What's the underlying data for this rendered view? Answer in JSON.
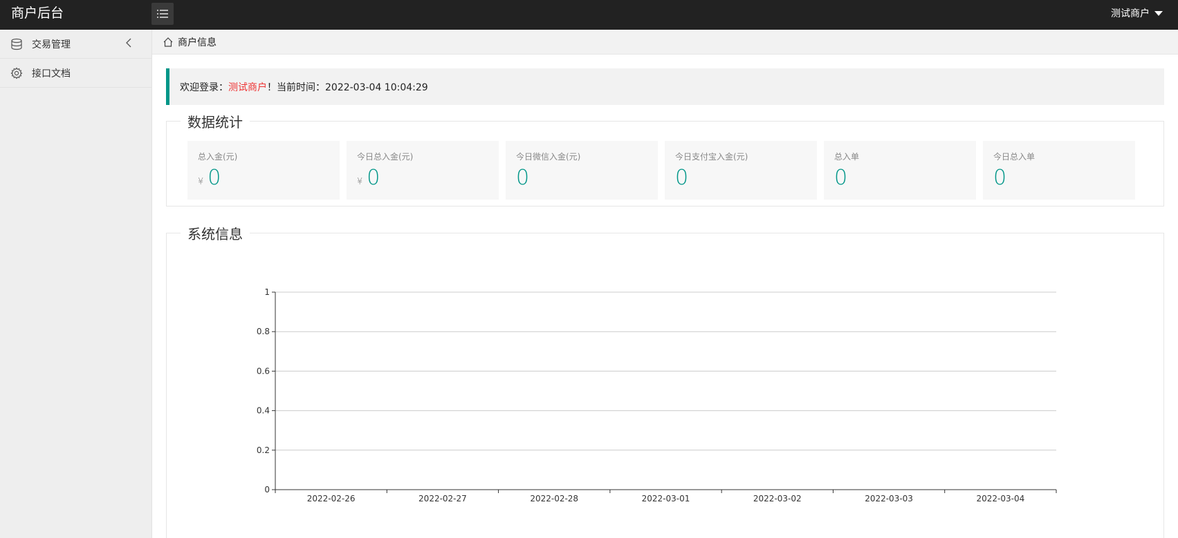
{
  "header": {
    "logo": "商户后台",
    "user": "测试商户"
  },
  "sidebar": {
    "items": [
      {
        "label": "交易管理",
        "icon": "database-icon"
      },
      {
        "label": "接口文档",
        "icon": "gear-icon"
      }
    ]
  },
  "breadcrumb": {
    "label": "商户信息"
  },
  "welcome": {
    "prefix": "欢迎登录：",
    "merchant": "测试商户",
    "suffix": "！当前时间：2022-03-04 10:04:29"
  },
  "stats_section": {
    "title": "数据统计",
    "items": [
      {
        "label": "总入金(元)",
        "currency": "¥",
        "value": "0"
      },
      {
        "label": "今日总入金(元)",
        "currency": "¥",
        "value": "0"
      },
      {
        "label": "今日微信入金(元)",
        "value": "0"
      },
      {
        "label": "今日支付宝入金(元)",
        "value": "0"
      },
      {
        "label": "总入单",
        "value": "0"
      },
      {
        "label": "今日总入单",
        "value": "0"
      }
    ]
  },
  "system_section": {
    "title": "系统信息"
  },
  "colors": {
    "accent": "#009688",
    "highlight": "#ee3333",
    "header_bg": "#222222"
  },
  "chart_data": {
    "type": "line",
    "title": "",
    "xlabel": "",
    "ylabel": "",
    "categories": [
      "2022-02-26",
      "2022-02-27",
      "2022-02-28",
      "2022-03-01",
      "2022-03-02",
      "2022-03-03",
      "2022-03-04"
    ],
    "series": [],
    "ylim": [
      0,
      1
    ],
    "yticks": [
      "0",
      "0.2",
      "0.4",
      "0.6",
      "0.8",
      "1"
    ],
    "grid": true
  }
}
